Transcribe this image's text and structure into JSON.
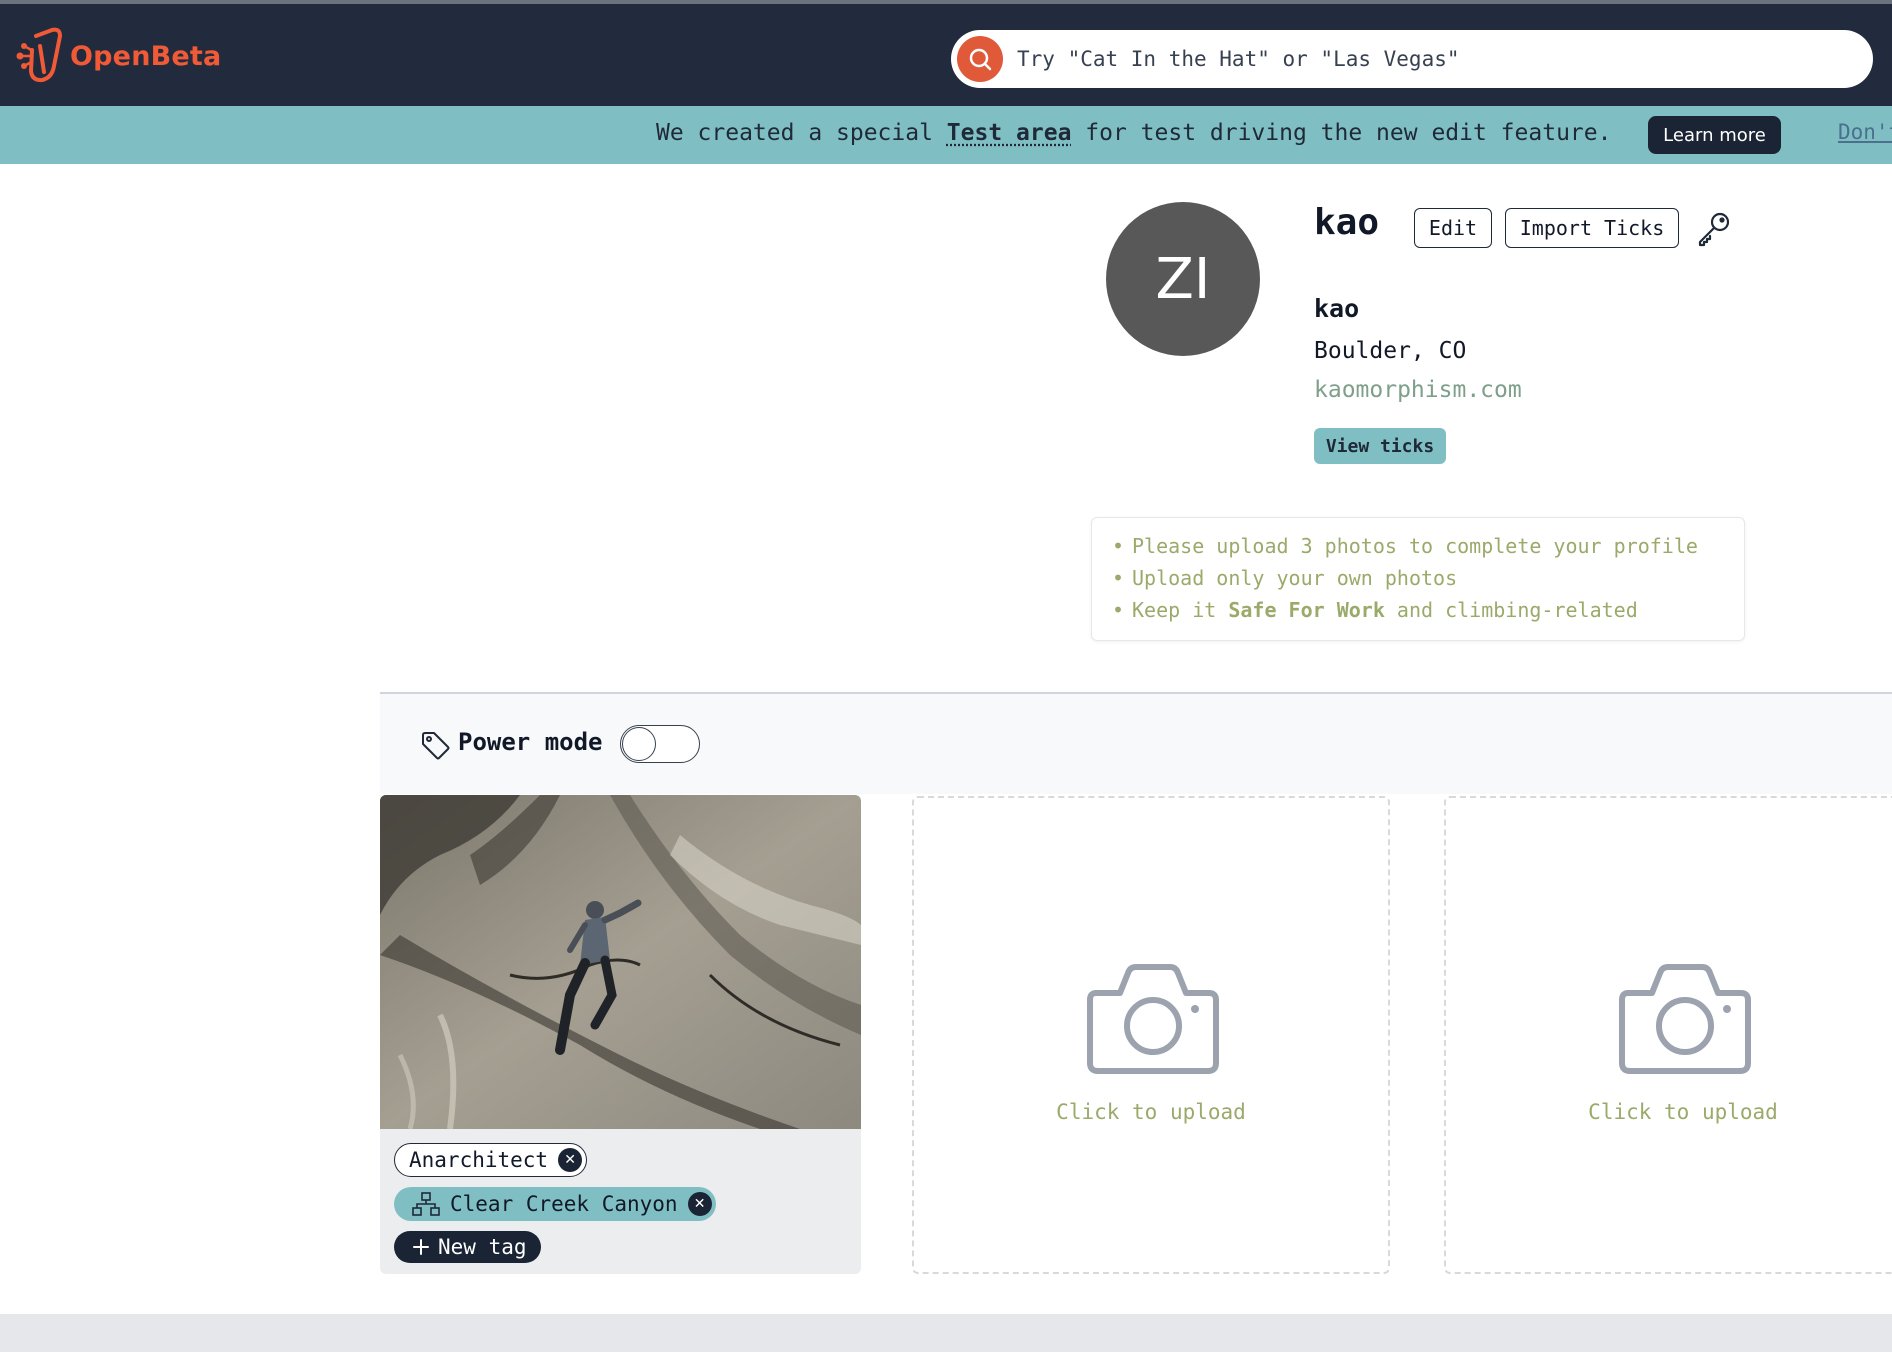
{
  "header": {
    "logo_text": "OpenBeta",
    "search_placeholder": "Try \"Cat In the Hat\" or \"Las Vegas\"",
    "brand_color": "#f15a37",
    "bg_color": "#222b3d"
  },
  "banner": {
    "message_before": "We created a special ",
    "message_link": "Test area",
    "message_after": " for test driving the new edit feature.",
    "learn_more_label": "Learn more",
    "dismiss_label": "Don't",
    "bg_color": "#7fbfc4"
  },
  "profile": {
    "avatar_initials": "ZI",
    "username": "kao",
    "edit_label": "Edit",
    "import_ticks_label": "Import Ticks",
    "display_name": "kao",
    "location": "Boulder, CO",
    "website": "kaomorphism.com",
    "view_ticks_label": "View ticks"
  },
  "guidelines": {
    "line1": "Please upload 3 photos to complete your profile",
    "line2": "Upload only your own photos",
    "line3_before": "Keep it ",
    "line3_bold": "Safe For Work",
    "line3_after": " and climbing-related"
  },
  "power_mode": {
    "label": "Power mode",
    "enabled": false
  },
  "gallery": {
    "photo": {
      "tags": [
        {
          "label": "Anarchitect",
          "type": "user"
        },
        {
          "label": "Clear Creek Canyon",
          "type": "area"
        }
      ],
      "new_tag_label": "New tag"
    },
    "upload_slots": [
      {
        "label": "Click to upload"
      },
      {
        "label": "Click to upload"
      }
    ]
  }
}
